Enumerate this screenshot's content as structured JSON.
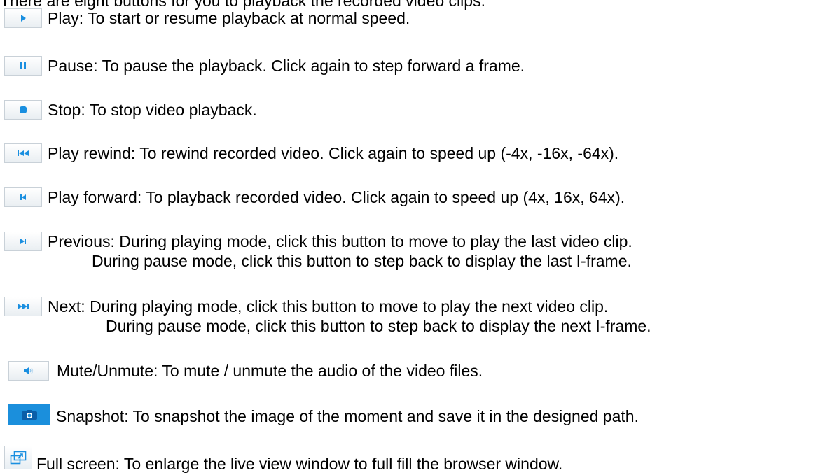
{
  "intro": "There are eight buttons for you to playback the recorded video clips.",
  "items": [
    {
      "icon": "play-icon",
      "text": "Play: To start or resume playback at normal speed."
    },
    {
      "icon": "pause-icon",
      "text": "Pause: To pause the playback. Click again to step forward a frame."
    },
    {
      "icon": "stop-icon",
      "text": "Stop: To stop video playback."
    },
    {
      "icon": "rewind-icon",
      "text": "Play rewind: To rewind recorded video. Click again to speed up (-4x, -16x, -64x)."
    },
    {
      "icon": "forward-icon",
      "text": "Play forward: To playback recorded video. Click again to speed up (4x, 16x, 64x)."
    },
    {
      "icon": "previous-icon",
      "text": "Previous: During playing mode, click this button to move to play the last video clip.",
      "cont": "During pause mode, click this button to step back to display the last I-frame."
    },
    {
      "icon": "next-icon",
      "text": "Next: During playing mode, click this button to move to play the next video clip.",
      "cont": "During pause mode, click this button to step back to display the next I-frame."
    },
    {
      "icon": "speaker-icon",
      "text": "Mute/Unmute: To mute / unmute the audio of the video files."
    },
    {
      "icon": "camera-icon",
      "text": "Snapshot: To snapshot the image of the moment and save it in the designed path."
    },
    {
      "icon": "fullscreen-icon",
      "text": "Full screen: To enlarge the live view window to full fill the browser window."
    }
  ],
  "colors": {
    "icon_blue": "#1a8fe0",
    "button_border": "#c9d1d8"
  }
}
